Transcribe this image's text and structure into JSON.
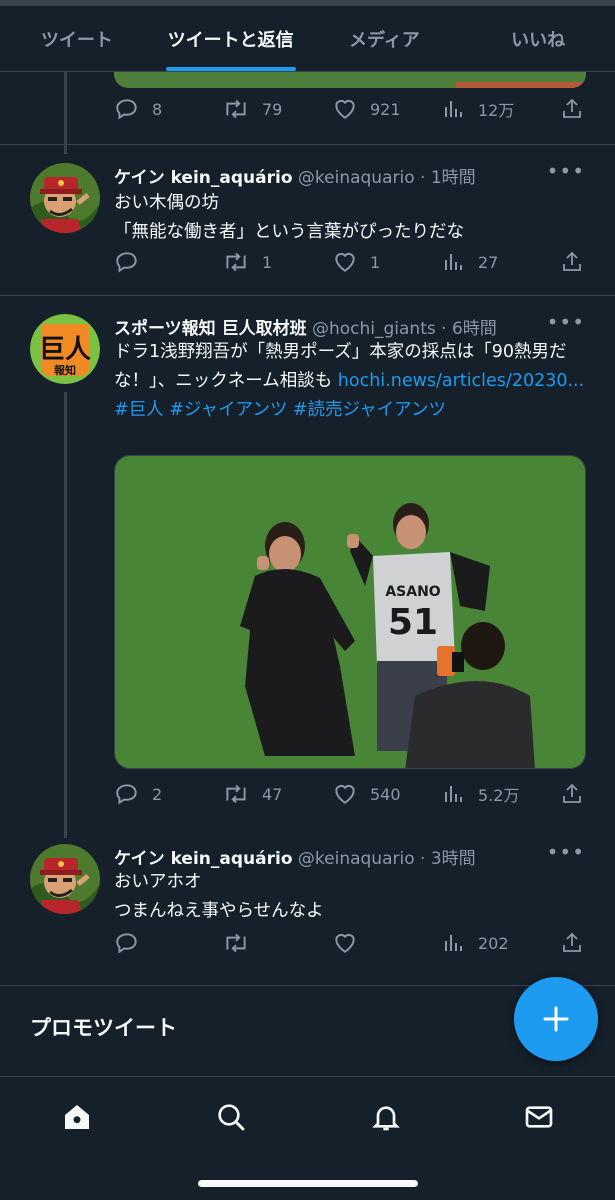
{
  "tabs": [
    {
      "label": "ツイート"
    },
    {
      "label": "ツイートと返信"
    },
    {
      "label": "メディア"
    },
    {
      "label": "いいね"
    }
  ],
  "tweets": [
    {
      "actions": {
        "reply": "8",
        "retweet": "79",
        "like": "921",
        "views": "12万"
      }
    },
    {
      "name": "ケイン kein_aquário",
      "handle": "@keinaquario",
      "time": "· 1時間",
      "lines": [
        "おい木偶の坊",
        "「無能な働き者」という言葉がぴったりだな"
      ],
      "actions": {
        "reply": "",
        "retweet": "1",
        "like": "1",
        "views": "27"
      }
    },
    {
      "name": "スポーツ報知 巨人取材班",
      "handle": "@hochi_giants",
      "time": "· 6時間",
      "text_plain_1": "ドラ1浅野翔吾が「熱男ポーズ」本家の採点は「90熱男だな！」、ニックネーム相談も ",
      "link": "hochi.news/articles/20230...",
      "hashtags": "#巨人 #ジャイアンツ #読売ジャイアンツ",
      "avatar_text": "巨人",
      "avatar_subtext": "報知",
      "jersey_name": "ASANO",
      "jersey_number": "51",
      "actions": {
        "reply": "2",
        "retweet": "47",
        "like": "540",
        "views": "5.2万"
      }
    },
    {
      "name": "ケイン kein_aquário",
      "handle": "@keinaquario",
      "time": "· 3時間",
      "lines": [
        "おいアホオ",
        "つまんねえ事やらせんなよ"
      ],
      "actions": {
        "reply": "",
        "retweet": "",
        "like": "",
        "views": "202"
      }
    }
  ],
  "promo": {
    "label": "プロモツイート"
  },
  "colors": {
    "bg": "#15202b",
    "accent": "#1d9bf0",
    "muted": "#8b98a5",
    "border": "#38444d"
  },
  "icons": [
    "reply-icon",
    "retweet-icon",
    "like-icon",
    "views-icon",
    "share-icon",
    "more-icon",
    "plus-icon",
    "home-icon",
    "search-icon",
    "bell-icon",
    "mail-icon"
  ]
}
